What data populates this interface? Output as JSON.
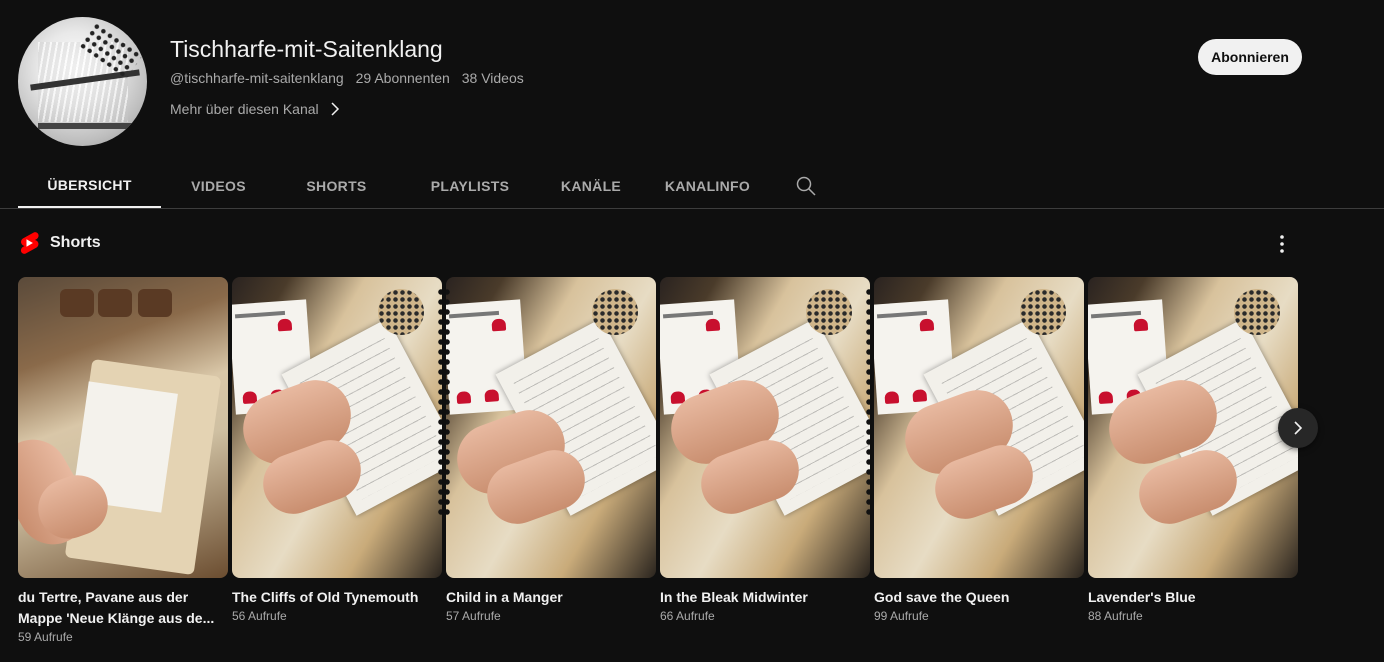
{
  "channel": {
    "title": "Tischharfe-mit-Saitenklang",
    "handle": "@tischharfe-mit-saitenklang",
    "subscribers": "29 Abonnenten",
    "videos": "38 Videos",
    "more_link": "Mehr über diesen Kanal",
    "subscribe_label": "Abonnieren"
  },
  "tabs": [
    {
      "label": "ÜBERSICHT",
      "active": true
    },
    {
      "label": "VIDEOS"
    },
    {
      "label": "SHORTS"
    },
    {
      "label": "PLAYLISTS"
    },
    {
      "label": "KANÄLE"
    },
    {
      "label": "KANALINFO"
    }
  ],
  "shorts_section": {
    "title": "Shorts",
    "items": [
      {
        "title": "du Tertre, Pavane aus der Mappe 'Neue Klänge aus de...",
        "views": "59 Aufrufe"
      },
      {
        "title": "The Cliffs of Old Tynemouth",
        "views": "56 Aufrufe"
      },
      {
        "title": "Child in a Manger",
        "views": "57 Aufrufe"
      },
      {
        "title": "In the Bleak Midwinter",
        "views": "66 Aufrufe"
      },
      {
        "title": "God save the Queen",
        "views": "99 Aufrufe"
      },
      {
        "title": "Lavender's Blue",
        "views": "88 Aufrufe"
      }
    ]
  },
  "icons": {
    "shorts_logo_color": "#ff0000",
    "search": "search-icon",
    "more": "more-vert-icon",
    "next": "chevron-right-icon"
  }
}
